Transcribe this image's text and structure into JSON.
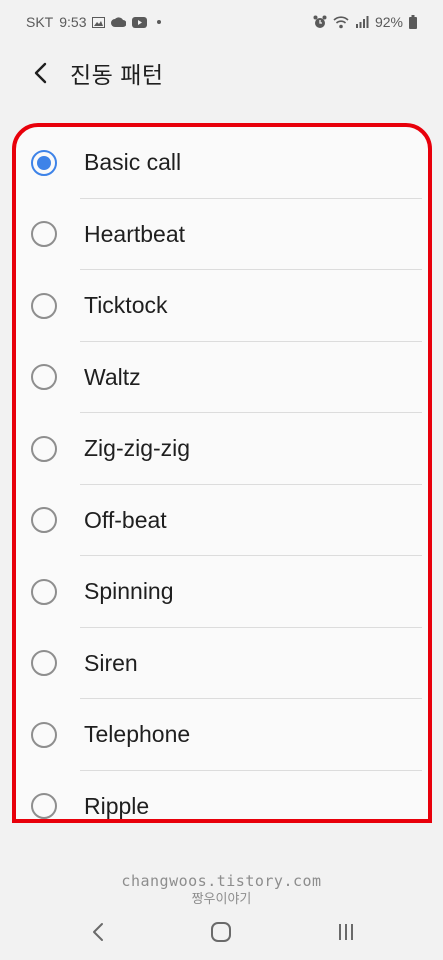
{
  "status_bar": {
    "carrier": "SKT",
    "time": "9:53",
    "battery": "92%"
  },
  "header": {
    "title": "진동 패턴"
  },
  "patterns": [
    {
      "label": "Basic call",
      "selected": true
    },
    {
      "label": "Heartbeat",
      "selected": false
    },
    {
      "label": "Ticktock",
      "selected": false
    },
    {
      "label": "Waltz",
      "selected": false
    },
    {
      "label": "Zig-zig-zig",
      "selected": false
    },
    {
      "label": "Off-beat",
      "selected": false
    },
    {
      "label": "Spinning",
      "selected": false
    },
    {
      "label": "Siren",
      "selected": false
    },
    {
      "label": "Telephone",
      "selected": false
    },
    {
      "label": "Ripple",
      "selected": false
    }
  ],
  "watermark": {
    "line1": "changwoos.tistory.com",
    "line2": "짱우이야기"
  },
  "colors": {
    "accent": "#3e83e8",
    "highlight_border": "#e8000b",
    "background": "#f2f2f2"
  }
}
